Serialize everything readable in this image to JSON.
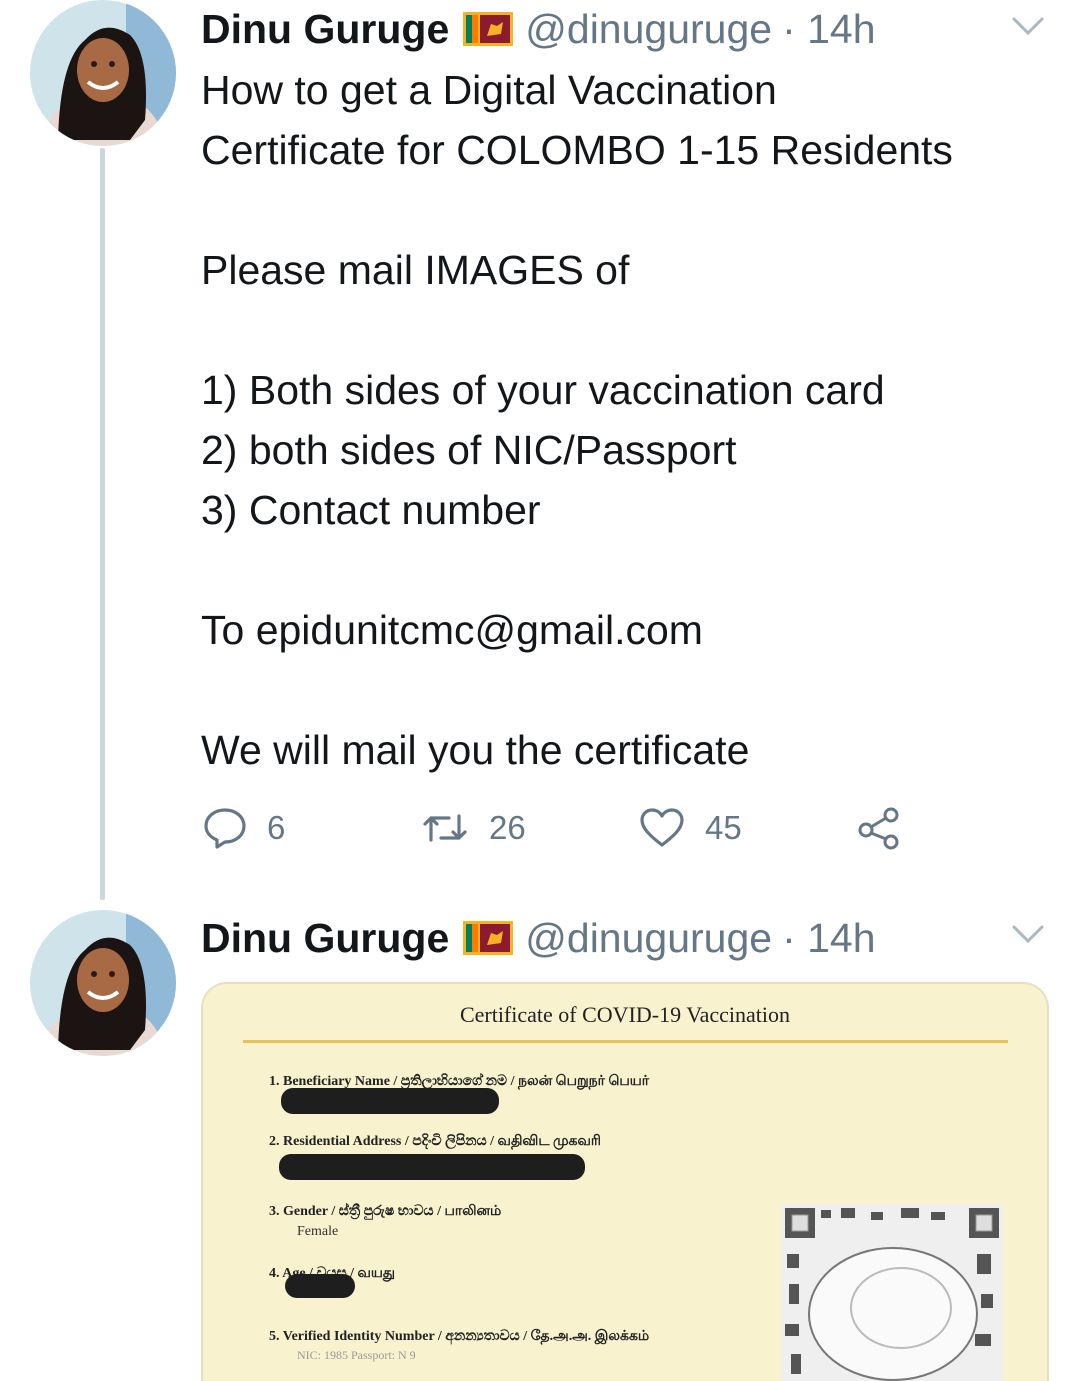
{
  "tweets": [
    {
      "author_name": "Dinu Guruge",
      "handle": "@dinuguruge",
      "time": "· 14h",
      "text_lines": [
        "How to get a Digital Vaccination",
        "Certificate for COLOMBO 1-15 Residents",
        "",
        "Please mail IMAGES of",
        "",
        "1) Both sides of your vaccination card",
        "2) both sides of NIC/Passport",
        "3) Contact number",
        "",
        "To epidunitcmc@gmail.com",
        "",
        "We will mail you the certificate"
      ],
      "replies": "6",
      "retweets": "26",
      "likes": "45"
    },
    {
      "author_name": "Dinu Guruge",
      "handle": "@dinuguruge",
      "time": "· 14h",
      "media": {
        "title": "Certificate of COVID-19 Vaccination",
        "fields": [
          "1. Beneficiary Name / ප්‍රතිලාභියාගේ නම / நலன் பெறுநர் பெயர்",
          "2. Residential Address / පදිංචි ලිපිනය / வதிவிட முகவரி",
          "3. Gender / ස්ත්‍රී පුරුෂ භාවය / பாலினம்",
          "4. Age / වයස / வயது",
          "5. Verified Identity Number / අනන්‍යතාවය / தே.அ.அ. இலக்கம்"
        ],
        "gender_value": "Female",
        "id_value": "NIC: 1985 Passport: N 9"
      }
    }
  ],
  "colors": {
    "text": "#14171a",
    "secondary": "#657786",
    "thread": "#ccd6dd"
  },
  "icons": [
    "reply-icon",
    "retweet-icon",
    "like-icon",
    "share-icon",
    "chevron-down-icon",
    "sri-lanka-flag-icon"
  ]
}
